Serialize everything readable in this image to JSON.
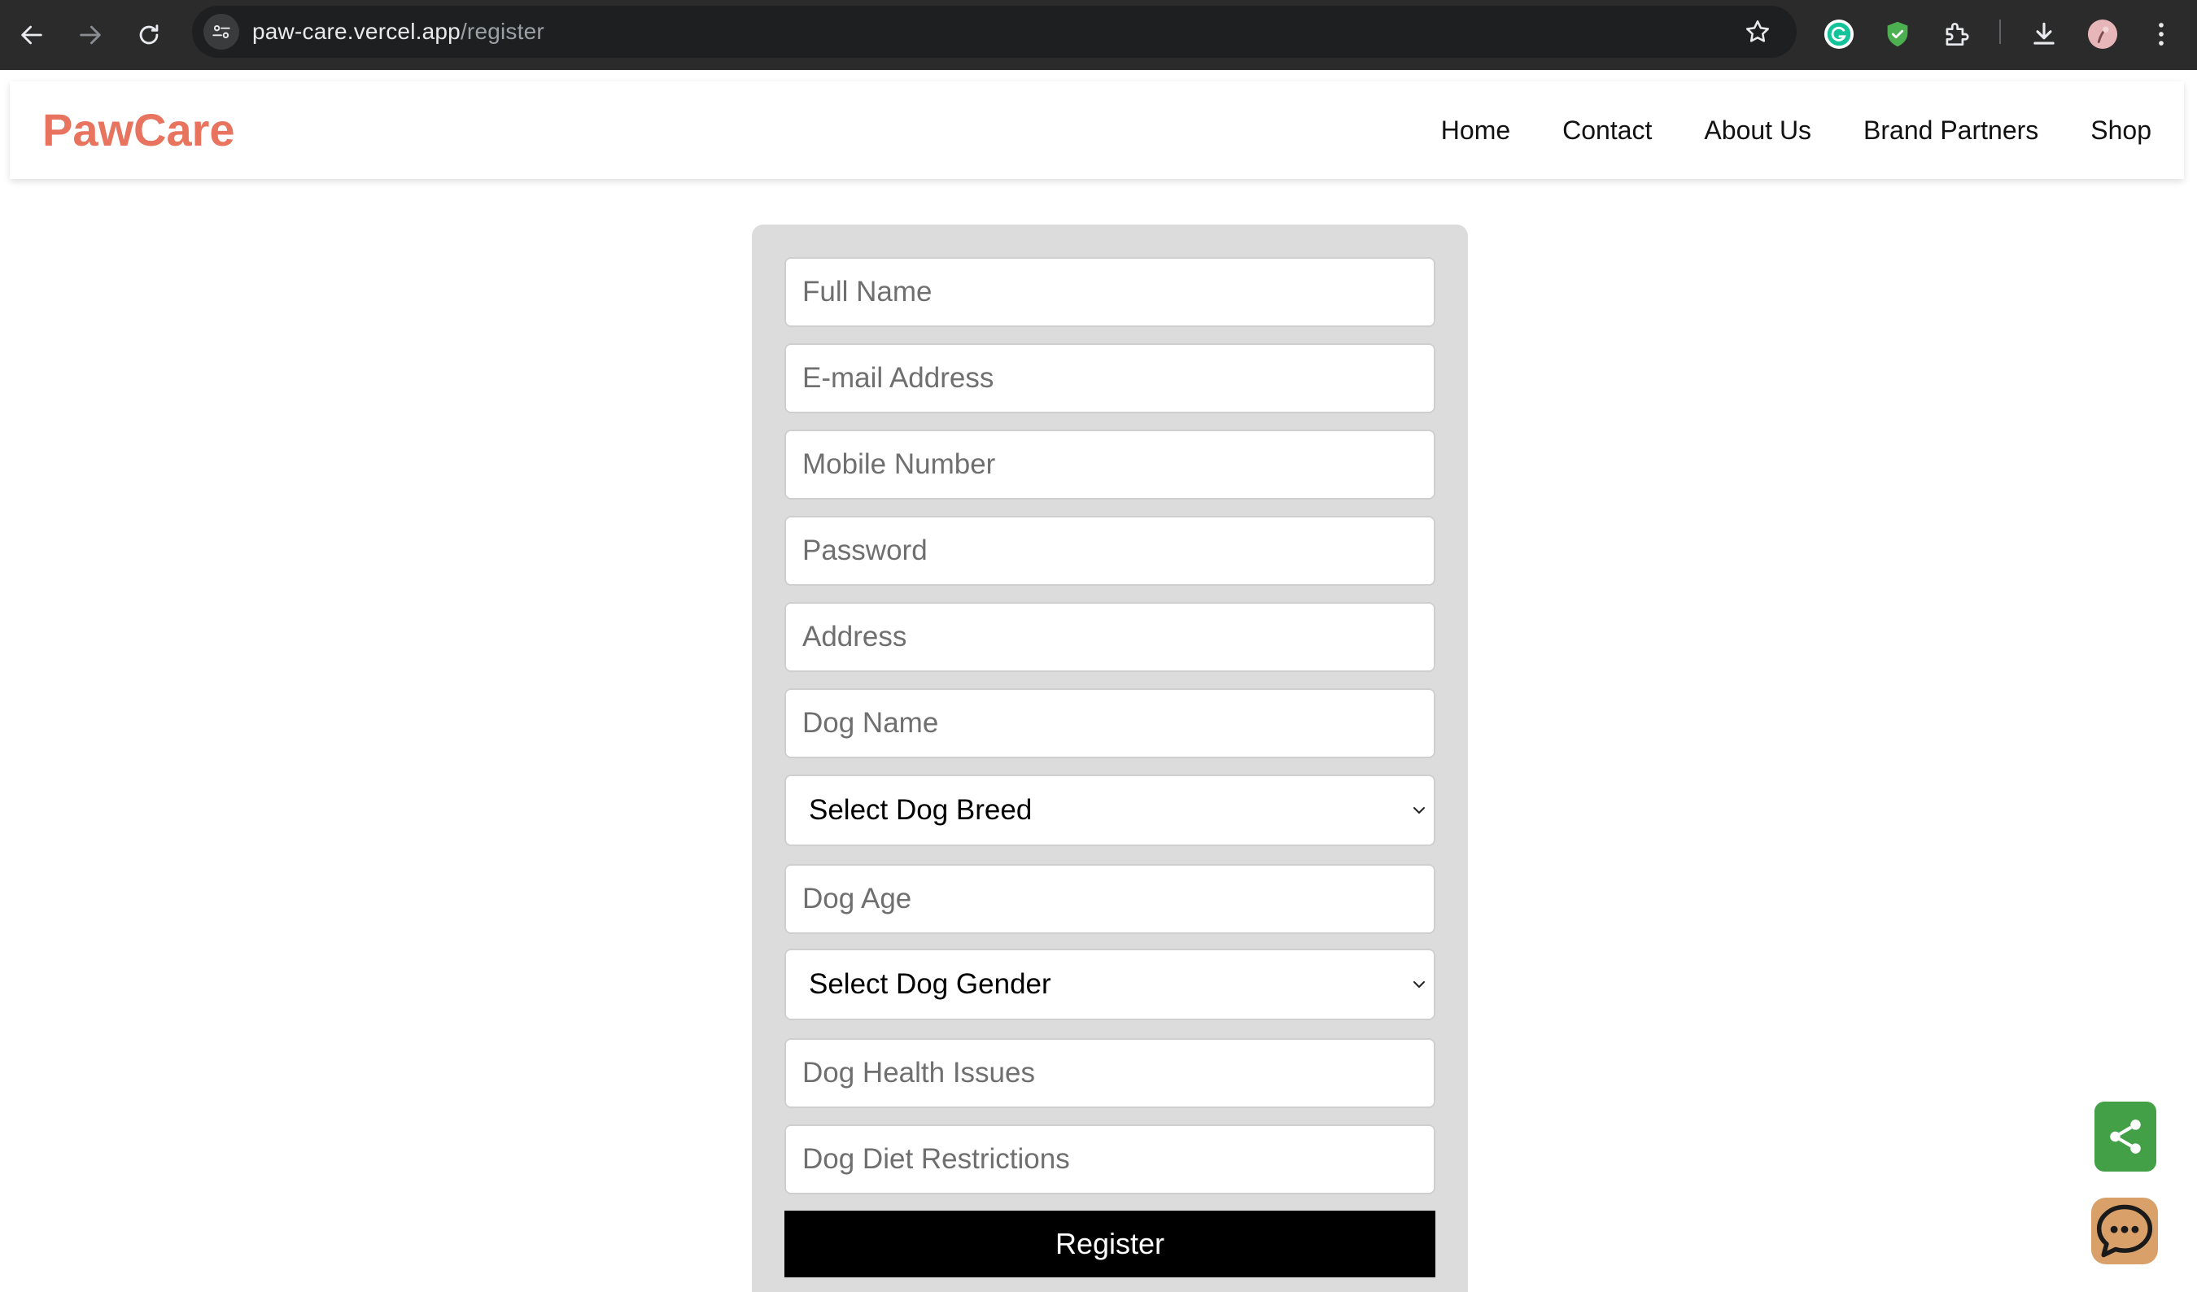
{
  "browser": {
    "url_host": "paw-care.vercel.app",
    "url_path": "/register"
  },
  "site": {
    "logo": "PawCare",
    "logo_color": "#e8735e",
    "nav": [
      "Home",
      "Contact",
      "About Us",
      "Brand Partners",
      "Shop"
    ]
  },
  "form": {
    "full_name_placeholder": "Full Name",
    "email_placeholder": "E-mail Address",
    "mobile_placeholder": "Mobile Number",
    "password_placeholder": "Password",
    "address_placeholder": "Address",
    "dog_name_placeholder": "Dog Name",
    "breed_select": "Select Dog Breed",
    "dog_age_placeholder": "Dog Age",
    "gender_select": "Select Dog Gender",
    "health_placeholder": "Dog Health Issues",
    "diet_placeholder": "Dog Diet Restrictions",
    "register_label": "Register"
  },
  "colors": {
    "share_button": "#43a047",
    "chat_button": "#d9a06a",
    "register_button": "#000000"
  }
}
